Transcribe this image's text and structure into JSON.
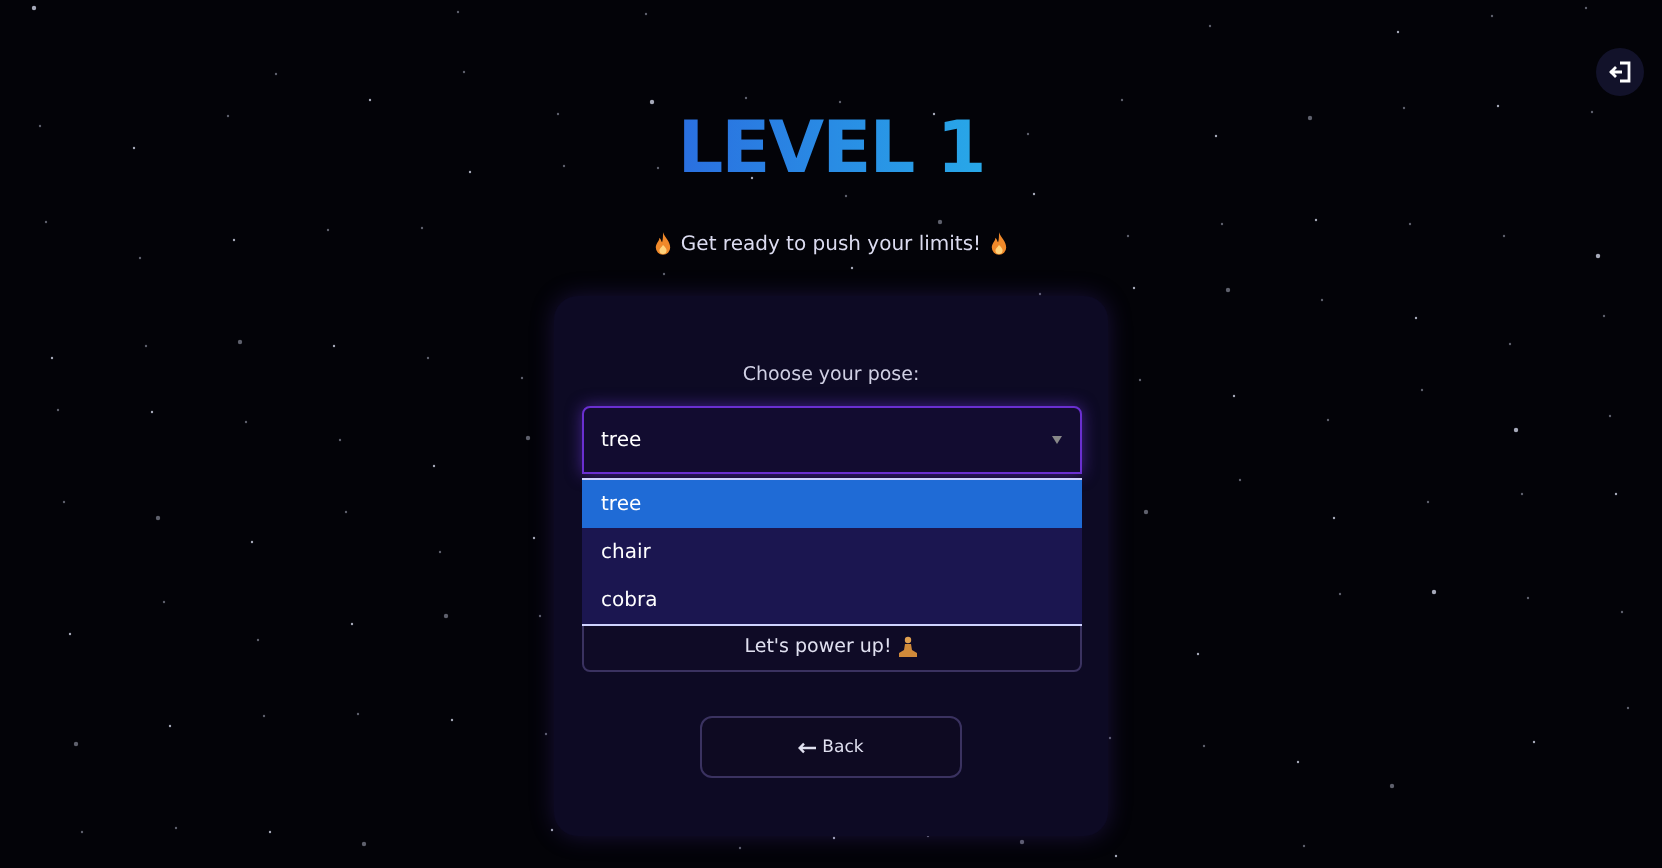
{
  "title": "LEVEL 1",
  "tagline": "Get ready to push your limits!",
  "prompt": "Choose your pose:",
  "select": {
    "value": "tree",
    "expanded": true,
    "options": [
      {
        "label": "tree",
        "selected": true
      },
      {
        "label": "chair",
        "selected": false
      },
      {
        "label": "cobra",
        "selected": false
      }
    ]
  },
  "power_button": "Let's power up!",
  "back_button": "Back"
}
